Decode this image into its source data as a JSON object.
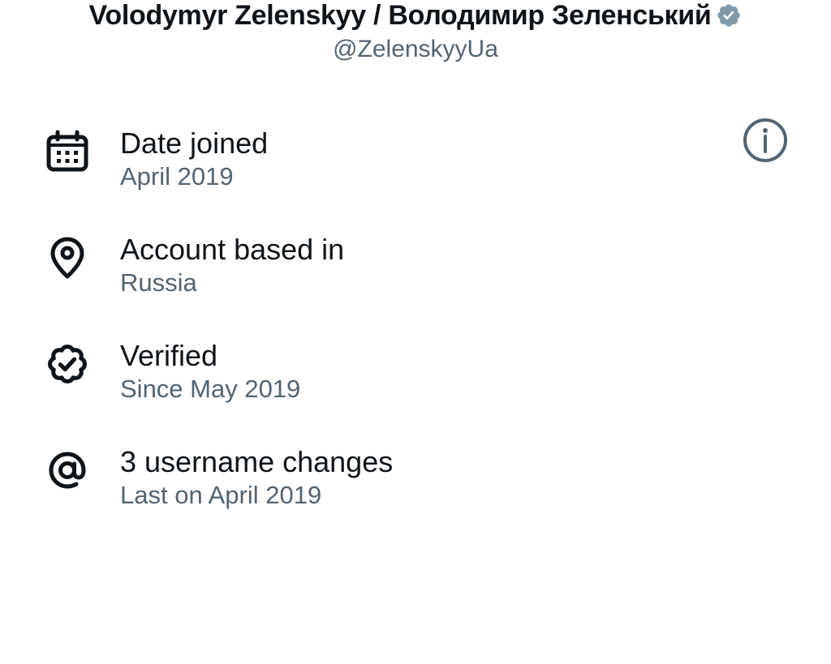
{
  "profile": {
    "display_name": "Volodymyr Zelenskyy / Володимир Зеленський",
    "handle": "@ZelenskyyUa",
    "verified_icon": "verified-badge-icon"
  },
  "rows": [
    {
      "icon": "calendar-icon",
      "title": "Date joined",
      "subtitle": "April 2019"
    },
    {
      "icon": "location-pin-icon",
      "title": "Account based in",
      "subtitle": "Russia",
      "action_icon": "info-icon"
    },
    {
      "icon": "verified-check-icon",
      "title": "Verified",
      "subtitle": "Since May 2019"
    },
    {
      "icon": "at-sign-icon",
      "title": "3 username changes",
      "subtitle": "Last on April 2019"
    }
  ],
  "colors": {
    "primary_text": "#0f1419",
    "secondary_text": "#536471",
    "badge_gray": "#829aab",
    "info_icon": "#536471"
  }
}
